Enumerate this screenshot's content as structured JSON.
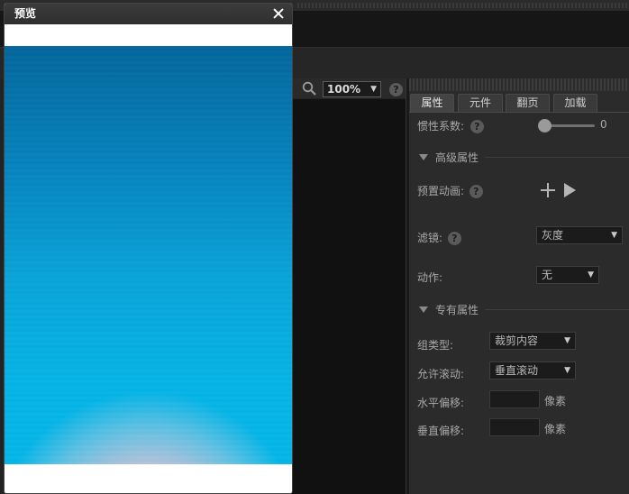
{
  "preview": {
    "title": "预览"
  },
  "canvas": {
    "zoom": "100%",
    "help": "?"
  },
  "panel": {
    "tabs": [
      "属性",
      "元件",
      "翻页",
      "加载"
    ],
    "active_tab": "属性",
    "inertia": {
      "label": "惯性系数:",
      "value": "0"
    },
    "advanced": {
      "title": "高级属性",
      "preset_anim_label": "预置动画:",
      "filter_label": "滤镜:",
      "filter_value": "灰度",
      "action_label": "动作:",
      "action_value": "无"
    },
    "special": {
      "title": "专有属性",
      "group_type_label": "组类型:",
      "group_type_value": "裁剪内容",
      "scroll_label": "允许滚动:",
      "scroll_value": "垂直滚动",
      "h_offset_label": "水平偏移:",
      "v_offset_label": "垂直偏移:",
      "unit": "像素"
    }
  },
  "colors": {
    "panel_bg": "#2b2b2b",
    "dark_bg": "#161616",
    "label": "#a8a8a8"
  }
}
